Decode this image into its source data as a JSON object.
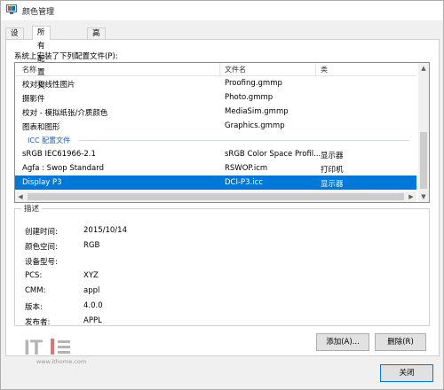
{
  "window": {
    "title": "颜色管理"
  },
  "tabs": [
    {
      "label": "设备"
    },
    {
      "label": "所有配置文件"
    },
    {
      "label": "高级"
    }
  ],
  "list": {
    "caption": "系统上安装了下列配置文件(P):",
    "columns": {
      "name": "名称",
      "file": "文件名",
      "type": "类"
    },
    "rows": [
      {
        "name": "校对和线性图片",
        "file": "Proofing.gmmp",
        "type": ""
      },
      {
        "name": "摄影",
        "file": "Photo.gmmp",
        "type": ""
      },
      {
        "name": "校对 - 模拟纸张/介质颜色",
        "file": "MediaSim.gmmp",
        "type": ""
      },
      {
        "name": "图表和图形",
        "file": "Graphics.gmmp",
        "type": ""
      },
      {
        "group": "ICC 配置文件"
      },
      {
        "name": "sRGB IEC61966-2.1",
        "file": "sRGB Color Space Profil...",
        "type": "显示器"
      },
      {
        "name": "Agfa : Swop Standard",
        "file": "RSWOP.icm",
        "type": "打印机"
      },
      {
        "name": "Display P3",
        "file": "DCI-P3.icc",
        "type": "显示器",
        "selected": true
      }
    ]
  },
  "description": {
    "title": "描述",
    "props": [
      {
        "label": "创建时间:",
        "value": "2015/10/14"
      },
      {
        "label": "颜色空间:",
        "value": "RGB"
      },
      {
        "label": "设备型号:",
        "value": ""
      },
      {
        "label": "PCS:",
        "value": "XYZ"
      },
      {
        "label": "CMM:",
        "value": "appl"
      },
      {
        "label": "版本:",
        "value": "4.0.0"
      },
      {
        "label": "发布者:",
        "value": "APPL"
      }
    ]
  },
  "buttons": {
    "add": "添加(A)...",
    "remove": "删除(R)",
    "close": "关闭"
  },
  "watermark": {
    "text": "www.ithome.com"
  },
  "colors": {
    "selection": "#0078d7",
    "group": "#1e5aa8"
  }
}
